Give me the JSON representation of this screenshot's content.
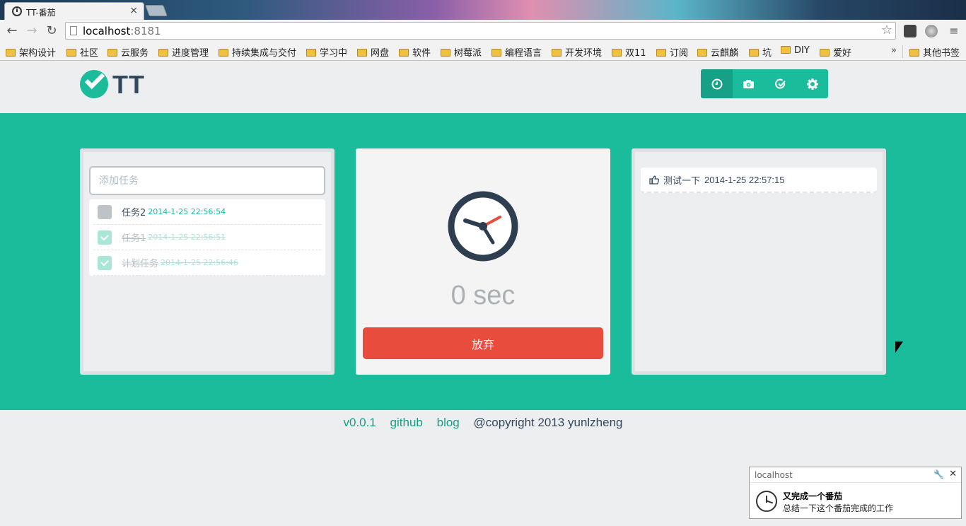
{
  "browser": {
    "tab_title": "TT-番茄",
    "tab_close": "×",
    "url_host": "localhost",
    "url_port": ":8181",
    "star": "☆",
    "bookmarks": [
      "架构设计",
      "社区",
      "云服务",
      "进度管理",
      "持续集成与交付",
      "学习中",
      "网盘",
      "软件",
      "树莓派",
      "编程语言",
      "开发环境",
      "双11",
      "订阅",
      "云麒麟",
      "坑",
      "DIY",
      "爱好"
    ],
    "bookmarks_more": "»",
    "other_bookmarks": "其他书签"
  },
  "app": {
    "logo_text": "TT",
    "accent_color": "#1abc9c",
    "nav_icons": [
      "clock-icon",
      "camera-icon",
      "check-circle-icon",
      "gear-icon"
    ]
  },
  "tasks": {
    "input_placeholder": "添加任务",
    "items": [
      {
        "name": "任务2",
        "time": "2014-1-25 22:56:54",
        "done": false
      },
      {
        "name": "任务1",
        "time": "2014-1-25 22:56:51",
        "done": true
      },
      {
        "name": "计划任务",
        "time": "2014-1-25 22:56:46",
        "done": true
      }
    ]
  },
  "timer": {
    "display": "0 sec",
    "giveup_label": "放弃",
    "button_color": "#e74c3c"
  },
  "log": {
    "items": [
      {
        "text": "测试一下",
        "time": "2014-1-25 22:57:15"
      }
    ]
  },
  "footer": {
    "version": "v0.0.1",
    "github": "github",
    "blog": "blog",
    "copyright": "@copyright 2013 yunlzheng"
  },
  "notification": {
    "origin": "localhost",
    "close": "✕",
    "title": "又完成一个番茄",
    "body": "总结一下这个番茄完成的工作"
  }
}
